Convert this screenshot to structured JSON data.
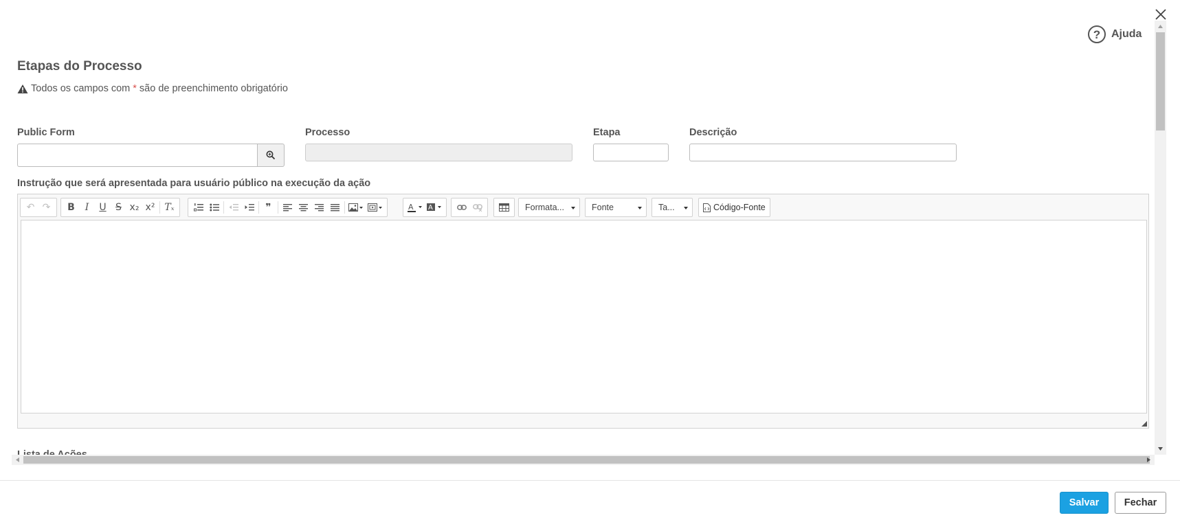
{
  "help": {
    "label": "Ajuda",
    "icon": "question-circle-icon"
  },
  "form": {
    "title": "Etapas do Processo",
    "required_note_prefix": "Todos os campos com",
    "required_star": "*",
    "required_note_suffix": "são de preenchimento obrigatório",
    "fields": {
      "public_form": {
        "label": "Public Form",
        "value": ""
      },
      "processo": {
        "label": "Processo",
        "value": ""
      },
      "etapa": {
        "label": "Etapa",
        "value": ""
      },
      "descricao": {
        "label": "Descrição",
        "value": ""
      }
    },
    "editor_label": "Instrução que será apresentada para usuário público na execução da ação",
    "editor_content": "",
    "next_section_label": "Lista de Ações"
  },
  "toolbar": {
    "format_combo": "Formata...",
    "font_combo": "Fonte",
    "size_combo": "Ta...",
    "source_button": "Código-Fonte"
  },
  "footer": {
    "save_label": "Salvar",
    "close_label": "Fechar"
  },
  "colors": {
    "primary": "#1ba1e2",
    "required": "#d9534f",
    "text": "#555555"
  }
}
